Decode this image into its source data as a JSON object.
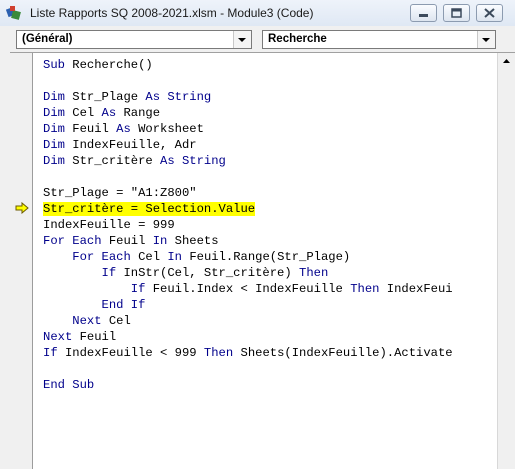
{
  "window": {
    "title": "Liste Rapports SQ 2008-2021.xlsm - Module3 (Code)",
    "icon": "vba-module-icon"
  },
  "combos": {
    "object": "(Général)",
    "procedure": "Recherche"
  },
  "code_lines": [
    [
      {
        "t": "kw",
        "v": "Sub"
      },
      {
        "t": "n",
        "v": " Recherche()"
      }
    ],
    [],
    [
      {
        "t": "kw",
        "v": "Dim"
      },
      {
        "t": "n",
        "v": " Str_Plage "
      },
      {
        "t": "kw",
        "v": "As String"
      }
    ],
    [
      {
        "t": "kw",
        "v": "Dim"
      },
      {
        "t": "n",
        "v": " Cel "
      },
      {
        "t": "kw",
        "v": "As"
      },
      {
        "t": "n",
        "v": " Range"
      }
    ],
    [
      {
        "t": "kw",
        "v": "Dim"
      },
      {
        "t": "n",
        "v": " Feuil "
      },
      {
        "t": "kw",
        "v": "As"
      },
      {
        "t": "n",
        "v": " Worksheet"
      }
    ],
    [
      {
        "t": "kw",
        "v": "Dim"
      },
      {
        "t": "n",
        "v": " IndexFeuille, Adr"
      }
    ],
    [
      {
        "t": "kw",
        "v": "Dim"
      },
      {
        "t": "n",
        "v": " Str_critère "
      },
      {
        "t": "kw",
        "v": "As String"
      }
    ],
    [],
    [
      {
        "t": "n",
        "v": "Str_Plage = \"A1:Z800\""
      }
    ],
    [
      {
        "t": "n",
        "v": "Str_critère = Selection.Value"
      }
    ],
    [
      {
        "t": "n",
        "v": "IndexFeuille = 999"
      }
    ],
    [
      {
        "t": "kw",
        "v": "For Each"
      },
      {
        "t": "n",
        "v": " Feuil "
      },
      {
        "t": "kw",
        "v": "In"
      },
      {
        "t": "n",
        "v": " Sheets"
      }
    ],
    [
      {
        "t": "n",
        "v": "    "
      },
      {
        "t": "kw",
        "v": "For Each"
      },
      {
        "t": "n",
        "v": " Cel "
      },
      {
        "t": "kw",
        "v": "In"
      },
      {
        "t": "n",
        "v": " Feuil.Range(Str_Plage)"
      }
    ],
    [
      {
        "t": "n",
        "v": "        "
      },
      {
        "t": "kw",
        "v": "If"
      },
      {
        "t": "n",
        "v": " InStr(Cel, Str_critère) "
      },
      {
        "t": "kw",
        "v": "Then"
      }
    ],
    [
      {
        "t": "n",
        "v": "            "
      },
      {
        "t": "kw",
        "v": "If"
      },
      {
        "t": "n",
        "v": " Feuil.Index < IndexFeuille "
      },
      {
        "t": "kw",
        "v": "Then"
      },
      {
        "t": "n",
        "v": " IndexFeui"
      }
    ],
    [
      {
        "t": "n",
        "v": "        "
      },
      {
        "t": "kw",
        "v": "End If"
      }
    ],
    [
      {
        "t": "n",
        "v": "    "
      },
      {
        "t": "kw",
        "v": "Next"
      },
      {
        "t": "n",
        "v": " Cel"
      }
    ],
    [
      {
        "t": "kw",
        "v": "Next"
      },
      {
        "t": "n",
        "v": " Feuil"
      }
    ],
    [
      {
        "t": "kw",
        "v": "If"
      },
      {
        "t": "n",
        "v": " IndexFeuille < 999 "
      },
      {
        "t": "kw",
        "v": "Then"
      },
      {
        "t": "n",
        "v": " Sheets(IndexFeuille).Activate"
      }
    ],
    [],
    [
      {
        "t": "kw",
        "v": "End Sub"
      }
    ]
  ],
  "highlighted_line": 9,
  "colors": {
    "keyword": "#00008b",
    "highlight": "#ffff00",
    "exec_arrow": "#ffff00"
  }
}
